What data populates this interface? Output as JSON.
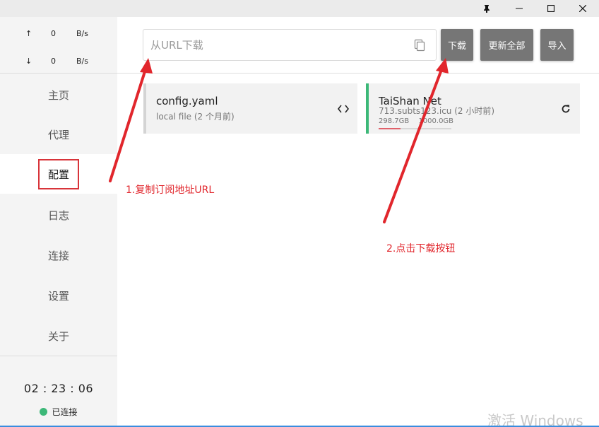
{
  "window": {
    "pin_icon": "pin-icon",
    "minimize_icon": "minimize-icon",
    "maximize_icon": "maximize-icon",
    "close_icon": "close-icon"
  },
  "traffic": {
    "up": {
      "arrow": "↑",
      "value": "0",
      "unit": "B/s"
    },
    "down": {
      "arrow": "↓",
      "value": "0",
      "unit": "B/s"
    }
  },
  "nav": {
    "items": [
      {
        "label": "主页"
      },
      {
        "label": "代理"
      },
      {
        "label": "配置",
        "active": true
      },
      {
        "label": "日志"
      },
      {
        "label": "连接"
      },
      {
        "label": "设置"
      },
      {
        "label": "关于"
      }
    ]
  },
  "status": {
    "clock": "02 : 23 : 06",
    "connection": "已连接",
    "dot_color": "#3cb878"
  },
  "toolbar": {
    "url_placeholder": "从URL下载",
    "url_value": "",
    "paste_icon": "copy-paste-icon",
    "download_label": "下载",
    "update_all_label": "更新全部",
    "import_label": "导入",
    "button_color": "#767676"
  },
  "profiles": [
    {
      "name": "config.yaml",
      "subtitle": "local file (2 个月前)",
      "bar_color": "#d4d4d4",
      "icon": "code-brackets-icon"
    },
    {
      "name": "TaiShan Net",
      "subtitle": "713.subts123.icu (2 小时前)",
      "used": "298.7GB",
      "total": "1000.0GB",
      "usage_fraction": 0.3,
      "bar_color": "#3cb878",
      "icon": "refresh-icon"
    }
  ],
  "annotations": {
    "step1": "1.复制订阅地址URL",
    "step2": "2.点击下载按钮",
    "color": "#e1262c"
  },
  "watermark": "激活 Windows"
}
